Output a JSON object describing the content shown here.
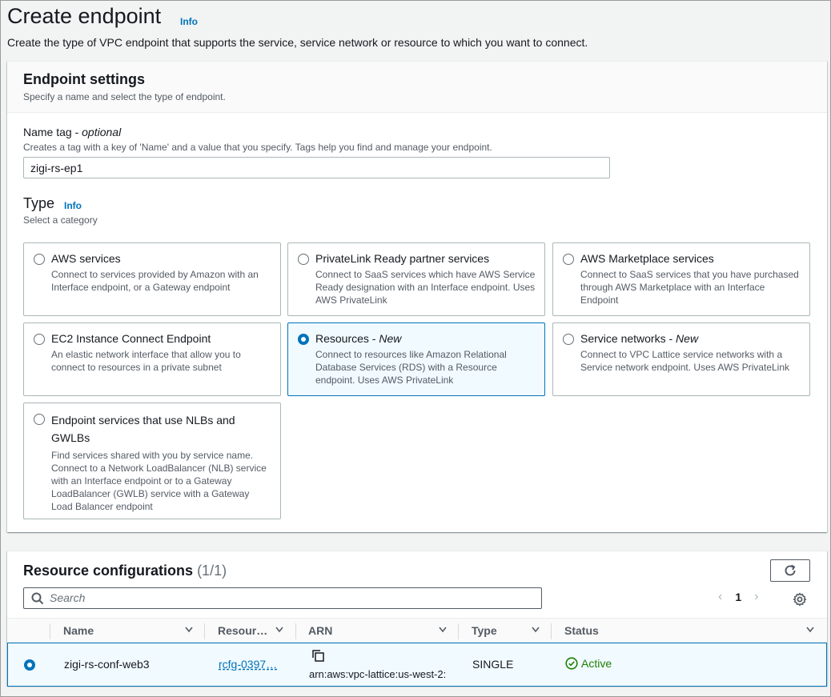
{
  "page": {
    "title": "Create endpoint",
    "info": "Info",
    "description": "Create the type of VPC endpoint that supports the service, service network or resource to which you want to connect."
  },
  "settings": {
    "header": "Endpoint settings",
    "subheader": "Specify a name and select the type of endpoint.",
    "name_label": "Name tag - ",
    "name_optional": "optional",
    "name_hint": "Creates a tag with a key of 'Name' and a value that you specify. Tags help you find and manage your endpoint.",
    "name_value": "zigi-rs-ep1",
    "type_label": "Type",
    "type_info": "Info",
    "type_hint": "Select a category",
    "tiles": [
      {
        "title": "AWS services",
        "new": "",
        "desc": "Connect to services provided by Amazon with an Interface endpoint, or a Gateway endpoint"
      },
      {
        "title": "PrivateLink Ready partner services",
        "new": "",
        "desc": "Connect to SaaS services which have AWS Service Ready designation with an Interface endpoint. Uses AWS PrivateLink"
      },
      {
        "title": "AWS Marketplace services",
        "new": "",
        "desc": "Connect to SaaS services that you have purchased through AWS Marketplace with an Interface Endpoint"
      },
      {
        "title": "EC2 Instance Connect Endpoint",
        "new": "",
        "desc": "An elastic network interface that allow you to connect to resources in a private subnet"
      },
      {
        "title": "Resources - ",
        "new": "New",
        "desc": "Connect to resources like Amazon Relational Database Services (RDS) with a Resource endpoint. Uses AWS PrivateLink"
      },
      {
        "title": "Service networks - ",
        "new": "New",
        "desc": "Connect to VPC Lattice service networks with a Service network endpoint. Uses AWS PrivateLink"
      },
      {
        "title": "Endpoint services that use NLBs and GWLBs",
        "new": "",
        "desc": "Find services shared with you by service name. Connect to a Network LoadBalancer (NLB) service with an Interface endpoint or to a Gateway LoadBalancer (GWLB) service with a Gateway Load Balancer endpoint"
      }
    ],
    "selected_tile": "Resources - New"
  },
  "resources": {
    "title": "Resource configurations",
    "count": "(1/1)",
    "search_placeholder": "Search",
    "page": "1",
    "columns": [
      "Name",
      "Resour…",
      "ARN",
      "Type",
      "Status"
    ],
    "rows": [
      {
        "name": "zigi-rs-conf-web3",
        "resource": "rcfg-0397…",
        "arn": "arn:aws:vpc-lattice:us-west-2:",
        "type": "SINGLE",
        "status": "Active"
      }
    ]
  },
  "colors": {
    "accent": "#0073bb",
    "success": "#1d8102",
    "selected_bg": "#f1faff"
  }
}
